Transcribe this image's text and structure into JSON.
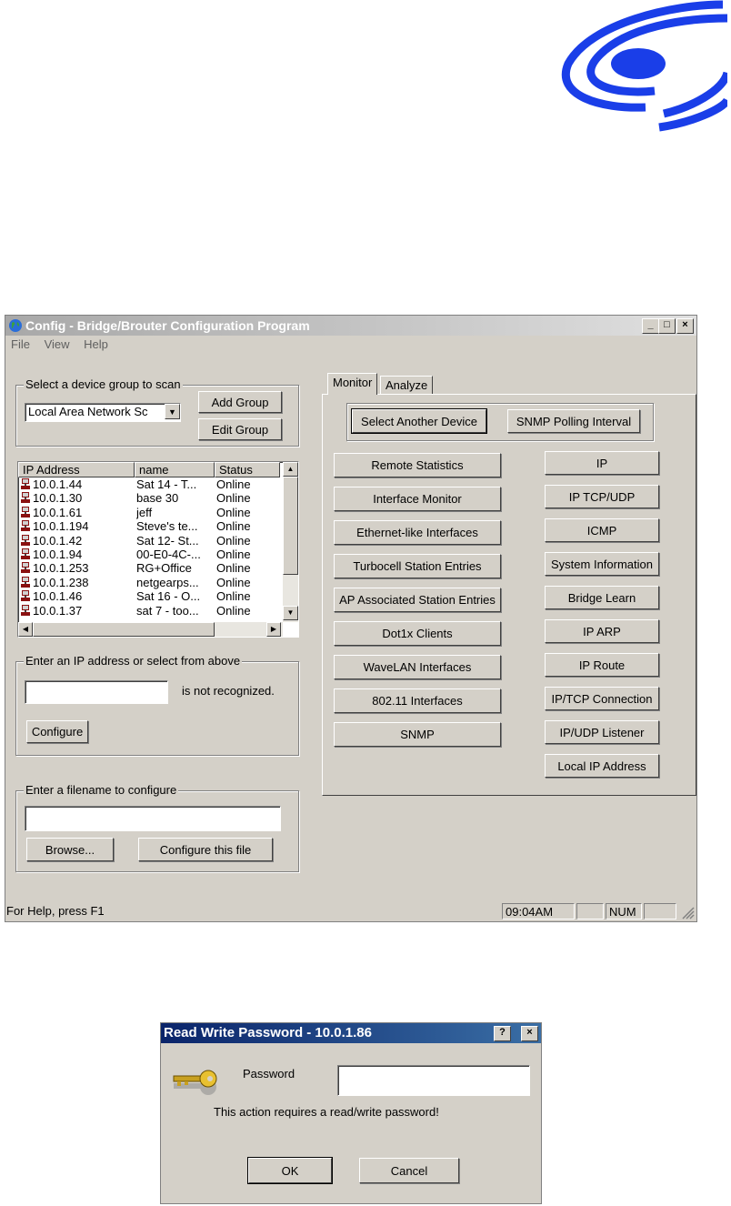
{
  "window": {
    "title": "Config - Bridge/Brouter Configuration Program",
    "menu": [
      "File",
      "View",
      "Help"
    ],
    "btn_minimize": "_",
    "btn_maximize": "□",
    "btn_close": "×"
  },
  "scan_group": {
    "label": "Select a device group to scan",
    "selected": "Local Area Network Sc",
    "add_button": "Add Group",
    "edit_button": "Edit Group"
  },
  "device_list": {
    "columns": [
      "IP Address",
      "name",
      "Status"
    ],
    "rows": [
      [
        "10.0.1.44",
        "Sat 14 - T...",
        "Online"
      ],
      [
        "10.0.1.30",
        "base 30",
        "Online"
      ],
      [
        "10.0.1.61",
        "jeff",
        "Online"
      ],
      [
        "10.0.1.194",
        "Steve's te...",
        "Online"
      ],
      [
        "10.0.1.42",
        "Sat 12- St...",
        "Online"
      ],
      [
        "10.0.1.94",
        "00-E0-4C-...",
        "Online"
      ],
      [
        "10.0.1.253",
        "RG+Office",
        "Online"
      ],
      [
        "10.0.1.238",
        "netgearps...",
        "Online"
      ],
      [
        "10.0.1.46",
        "Sat 16 - O...",
        "Online"
      ],
      [
        "10.0.1.37",
        "sat 7 - too...",
        "Online"
      ]
    ]
  },
  "ip_group": {
    "label": "Enter an IP address or select from above",
    "value": "",
    "status_text": "is not recognized.",
    "configure_button": "Configure"
  },
  "file_group": {
    "label": "Enter a filename to configure",
    "value": "",
    "browse_button": "Browse...",
    "configure_file_button": "Configure this file"
  },
  "tabs": [
    "Monitor",
    "Analyze"
  ],
  "monitor": {
    "select_device": "Select Another Device",
    "snmp_polling": "SNMP Polling Interval",
    "left_buttons": [
      "Remote Statistics",
      "Interface Monitor",
      "Ethernet-like Interfaces",
      "Turbocell Station Entries",
      "AP Associated Station Entries",
      "Dot1x Clients",
      "WaveLAN Interfaces",
      "802.11 Interfaces",
      "SNMP"
    ],
    "right_buttons": [
      "IP",
      "IP TCP/UDP",
      "ICMP",
      "System Information",
      "Bridge Learn",
      "IP ARP",
      "IP Route",
      "IP/TCP Connection",
      "IP/UDP Listener",
      "Local IP Address"
    ]
  },
  "statusbar": {
    "help": "For Help, press F1",
    "time": "09:04AM",
    "num": "NUM"
  },
  "dialog": {
    "title": "Read Write Password - 10.0.1.86",
    "help_btn": "?",
    "close_btn": "×",
    "password_label": "Password",
    "password_value": "",
    "message": "This action requires a read/write password!",
    "ok": "OK",
    "cancel": "Cancel"
  },
  "colors": {
    "logo": "#1a3ee8",
    "face": "#d4d0c8",
    "dialog_title": "#0a246a"
  }
}
